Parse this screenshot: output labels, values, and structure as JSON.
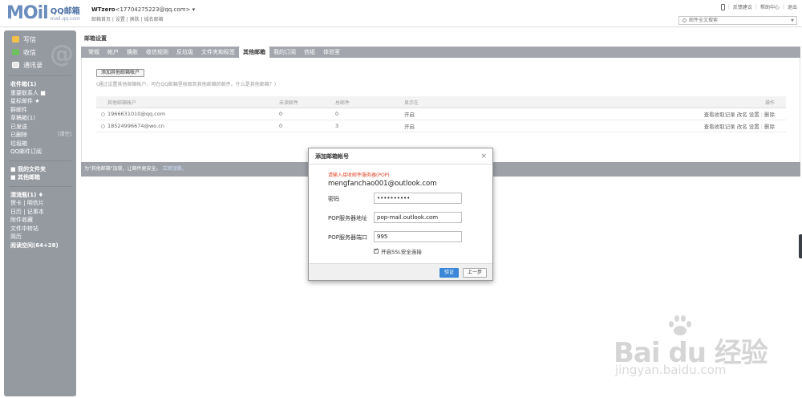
{
  "header": {
    "logo_mark": "MOil",
    "logo_title": "QQ邮箱",
    "logo_sub": "mail.qq.com",
    "account_name": "WTzero",
    "account_email": "<17704275223@qq.com>",
    "account_links": [
      "邮箱首页",
      "设置",
      "换肤",
      "城名邮箱"
    ],
    "top_links": [
      "反馈建议",
      "帮助中心",
      "退出"
    ],
    "search_placeholder": "邮件全文搜索"
  },
  "sidebar": {
    "buttons": [
      {
        "label": "写信",
        "icon": "pencil-icon"
      },
      {
        "label": "收信",
        "icon": "inbox-icon"
      },
      {
        "label": "通讯录",
        "icon": "contacts-icon"
      }
    ],
    "folders": [
      {
        "label": "收件箱(1)",
        "bold": true
      },
      {
        "label": "重要联系人 ■",
        "bold": false
      },
      {
        "label": "星标邮件 ★",
        "bold": false
      },
      {
        "label": "群邮件",
        "bold": false
      },
      {
        "label": "草稿箱(1)",
        "bold": false
      },
      {
        "label": "已发送",
        "bold": false
      },
      {
        "label": "已删除",
        "bold": false,
        "extra": "[清空]"
      },
      {
        "label": "垃圾箱",
        "bold": false
      },
      {
        "label": "QQ邮件订阅",
        "bold": false
      }
    ],
    "sections": [
      "■ 我的文件夹",
      "■ 其他邮箱"
    ],
    "apps": [
      {
        "label": "漂流瓶(1) ♦",
        "bold": true
      },
      {
        "label": "贺卡 | 明信片",
        "bold": false
      },
      {
        "label": "日历 | 记事本",
        "bold": false
      },
      {
        "label": "附件收藏",
        "bold": false
      },
      {
        "label": "文件中转站",
        "bold": false
      },
      {
        "label": "简历",
        "bold": false
      },
      {
        "label": "阅读空间(64+28)",
        "bold": true
      }
    ]
  },
  "main": {
    "title": "邮箱设置",
    "tabs": [
      "常规",
      "帐户",
      "换肤",
      "收信规则",
      "反垃圾",
      "文件夹和标签",
      "其他邮箱",
      "我的订阅",
      "信纸",
      "体验室"
    ],
    "active_tab": 6,
    "add_button": "添加其他邮箱帐户",
    "hint": "(通过设置其他邮箱帐户，可在QQ邮箱里收取到其他邮箱的邮件。什么是其他邮箱？)",
    "table": {
      "headers": [
        "其他邮箱帐户",
        "未读邮件",
        "总邮件",
        "显示在",
        "操作"
      ],
      "rows": [
        {
          "account": "1966631010@qq.com",
          "unread": "0",
          "total": "0",
          "show": "开启"
        },
        {
          "account": "18524996674@wo.cn",
          "unread": "0",
          "total": "3",
          "show": "开启"
        }
      ],
      "ops": [
        "查看收取记录",
        "改名",
        "设置",
        "删除"
      ]
    },
    "footer_text": "为\"其他邮箱\"加锁，让邮件更安全。",
    "footer_link": "立即加锁。"
  },
  "dialog": {
    "title": "添加邮箱帐号",
    "tip": "请输入接收邮件服务器(POP)",
    "email": "mengfanchao001@outlook.com",
    "password_label": "密码",
    "password_value": "••••••••••",
    "pop_label": "POP服务器地址",
    "pop_value": "pop-mail.outlook.com",
    "port_label": "POP服务器端口",
    "port_value": "995",
    "ssl_label": "开启SSL安全连接",
    "verify_button": "验证",
    "prev_button": "上一步"
  },
  "watermark": {
    "text": "Bai du 经验",
    "url": "jingyan.baidu.com"
  }
}
